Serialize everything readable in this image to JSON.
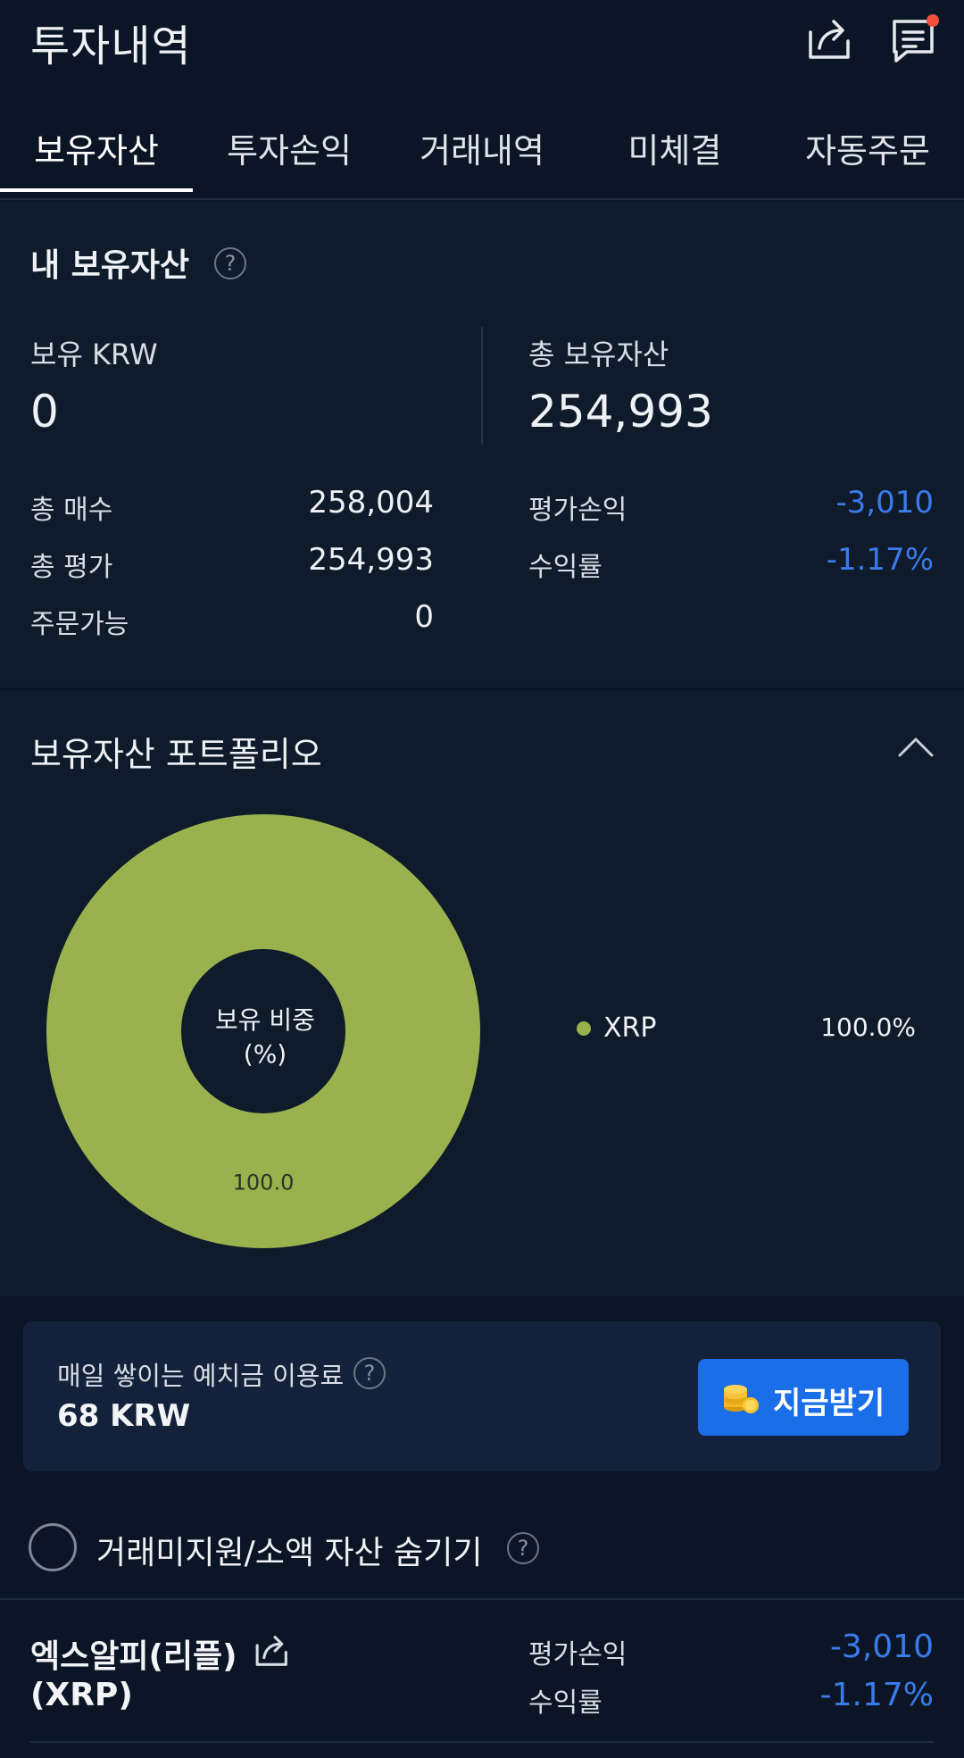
{
  "header": {
    "title": "투자내역",
    "share_icon": "share-icon",
    "message_icon": "message-icon"
  },
  "tabs": [
    {
      "label": "보유자산",
      "active": true
    },
    {
      "label": "투자손익",
      "active": false
    },
    {
      "label": "거래내역",
      "active": false
    },
    {
      "label": "미체결",
      "active": false
    },
    {
      "label": "자동주문",
      "active": false
    }
  ],
  "holdings": {
    "title": "내 보유자산",
    "krw_label": "보유 KRW",
    "krw_value": "0",
    "total_label": "총 보유자산",
    "total_value": "254,993",
    "buy_label": "총 매수",
    "buy_value": "258,004",
    "eval_label": "총 평가",
    "eval_value": "254,993",
    "orderable_label": "주문가능",
    "orderable_value": "0",
    "pnl_label": "평가손익",
    "pnl_value": "-3,010",
    "rate_label": "수익률",
    "rate_value": "-1.17%",
    "negative_color": "#3a7bea"
  },
  "portfolio": {
    "title": "보유자산 포트폴리오",
    "center_label_1": "보유 비중",
    "center_label_2": "(%)",
    "legend": [
      {
        "name": "XRP",
        "percent": "100.0%",
        "color": "#9ab24e"
      }
    ]
  },
  "chart_data": {
    "type": "pie",
    "categories": [
      "XRP"
    ],
    "values": [
      100.0
    ],
    "colors": [
      "#9ab24e"
    ],
    "slice_labels": [
      "100.0"
    ]
  },
  "deposit": {
    "label": "매일 쌓이는 예치금 이용료",
    "value": "68 KRW",
    "button_label": "지금받기",
    "button_color": "#1a6ee8"
  },
  "filter": {
    "label": "거래미지원/소액 자산 숨기기"
  },
  "asset": {
    "name_line1": "엑스알피(리플)",
    "name_line2": "(XRP)",
    "pnl_label": "평가손익",
    "pnl_value": "-3,010",
    "rate_label": "수익률",
    "rate_value": "-1.17%"
  }
}
